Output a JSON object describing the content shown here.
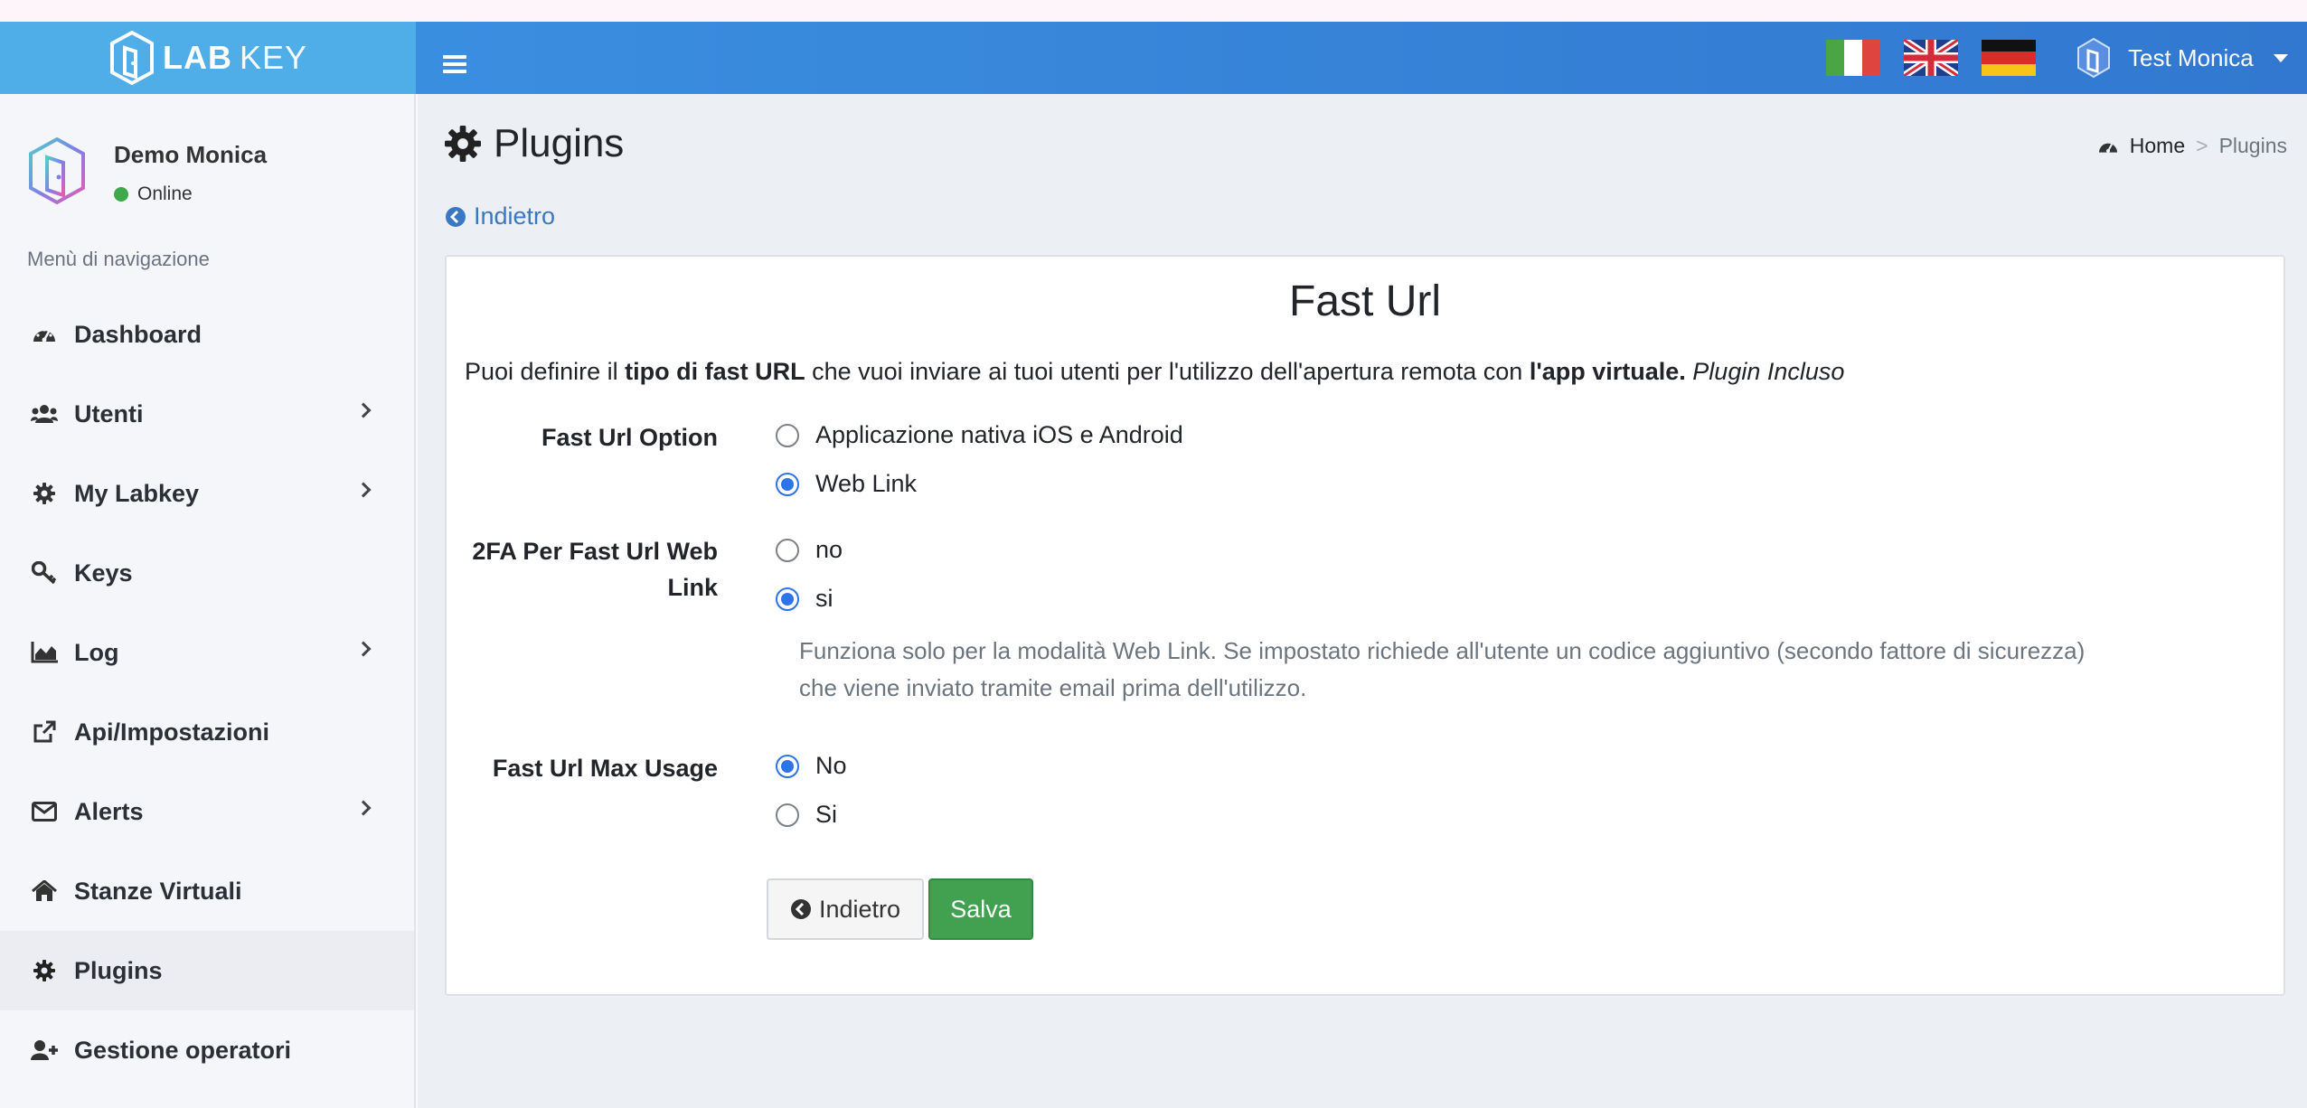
{
  "app": {
    "logo_bold": "LAB",
    "logo_light": "KEY"
  },
  "header": {
    "user_name": "Test Monica",
    "flags": [
      "flag-it-icon",
      "flag-uk-icon",
      "flag-de-icon"
    ]
  },
  "sidebar": {
    "profile_name": "Demo Monica",
    "profile_status": "Online",
    "menu_header": "Menù di navigazione",
    "items": [
      {
        "label": "Dashboard",
        "icon": "dashboard-icon",
        "has_submenu": false
      },
      {
        "label": "Utenti",
        "icon": "users-icon",
        "has_submenu": true
      },
      {
        "label": "My Labkey",
        "icon": "gear-icon",
        "has_submenu": true
      },
      {
        "label": "Keys",
        "icon": "key-icon",
        "has_submenu": false
      },
      {
        "label": "Log",
        "icon": "chart-area-icon",
        "has_submenu": true
      },
      {
        "label": "Api/Impostazioni",
        "icon": "external-link-icon",
        "has_submenu": false
      },
      {
        "label": "Alerts",
        "icon": "envelope-icon",
        "has_submenu": true
      },
      {
        "label": "Stanze Virtuali",
        "icon": "home-icon",
        "has_submenu": false
      },
      {
        "label": "Plugins",
        "icon": "gear-icon",
        "has_submenu": false,
        "active": true
      },
      {
        "label": "Gestione operatori",
        "icon": "user-plus-icon",
        "has_submenu": false
      }
    ]
  },
  "page": {
    "title": "Plugins",
    "breadcrumb_home": "Home",
    "breadcrumb_sep": ">",
    "breadcrumb_current": "Plugins",
    "back_link": "Indietro"
  },
  "card": {
    "title": "Fast Url",
    "desc_1": "Puoi definire il ",
    "desc_2": "tipo di fast URL",
    "desc_3": " che vuoi inviare ai tuoi utenti per l'utilizzo dell'apertura remota con ",
    "desc_4": "l'app virtuale.",
    "desc_5": " Plugin Incluso",
    "fields": {
      "option_label": "Fast Url Option",
      "option_choices": [
        "Applicazione nativa iOS e Android",
        "Web Link"
      ],
      "option_selected": "Web Link",
      "twofa_label_line1": "2FA Per Fast Url Web",
      "twofa_label_line2": "Link",
      "twofa_choices": [
        "no",
        "si"
      ],
      "twofa_selected": "si",
      "twofa_help_1": "Funziona solo per la modalità Web Link. Se impostato richiede all'utente un codice aggiuntivo (secondo fattore di sicurezza)",
      "twofa_help_2": "che viene inviato tramite email prima dell'utilizzo.",
      "max_usage_label": "Fast Url Max Usage",
      "max_usage_choices": [
        "No",
        "Si"
      ],
      "max_usage_selected": "No"
    },
    "btn_back": "Indietro",
    "btn_save": "Salva"
  },
  "colors": {
    "brand": "#4faee8",
    "navbar": "#3a8ee0",
    "link": "#3a78c2",
    "radio_selected": "#2d74e8",
    "save_button": "#42a150",
    "online": "#3fa84a"
  }
}
